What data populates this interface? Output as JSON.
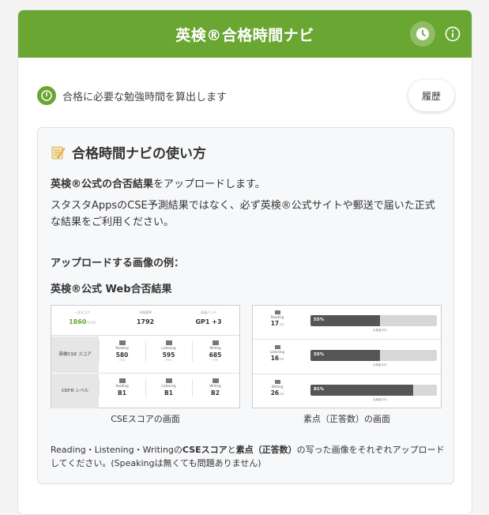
{
  "header": {
    "title": "英検®合格時間ナビ",
    "clock_icon": "clock-icon",
    "info_icon": "info-icon",
    "accent": "#6aa632"
  },
  "subheader": {
    "text": "合格に必要な勉強時間を算出します",
    "history_label": "履歴"
  },
  "howto": {
    "title": "合格時間ナビの使い方",
    "p1_bold": "英検®公式の合否結果",
    "p1_rest": "をアップロードします。",
    "p2": "スタスタAppsのCSE予測結果ではなく、必ず英検®公式サイトや郵送で届いた正式な結果をご利用ください。",
    "upload_heading": "アップロードする画像の例：",
    "web_heading": "英検®公式 Web合否結果",
    "caption_a": "CSEスコアの画面",
    "caption_b": "素点（正答数）の画面",
    "note_a": "Reading・Listening・Writingの",
    "note_b1": "CSEスコア",
    "note_c": "と",
    "note_b2": "素点（正答数）",
    "note_d": "の写った画像をそれぞれアップロードしてください。(Speakingは無くても問題ありません)"
  },
  "sample_cse": {
    "top": [
      {
        "label": "一次スコア",
        "value": "1860",
        "sub": "/2150",
        "green": true
      },
      {
        "label": "合格基準",
        "value": "1792",
        "green": false
      },
      {
        "label": "英検バンド",
        "value": "GP1 +3",
        "green": false
      }
    ],
    "row_cse_label": "英検CSE スコア",
    "row_cefr_label": "CEFR レベル",
    "skills": [
      {
        "name": "Reading",
        "cse": "580",
        "cse_max": "/750",
        "cefr": "B1"
      },
      {
        "name": "Listening",
        "cse": "595",
        "cse_max": "/750",
        "cefr": "B1"
      },
      {
        "name": "Writing",
        "cse": "685",
        "cse_max": "/750",
        "cefr": "B2"
      }
    ]
  },
  "sample_raw": [
    {
      "name": "Reading",
      "score": "17",
      "max": "/31",
      "percent": 55
    },
    {
      "name": "Listening",
      "score": "16",
      "max": "/29",
      "percent": 55
    },
    {
      "name": "Writing",
      "score": "26",
      "max": "/32",
      "percent": 81
    }
  ],
  "sample_raw_avg_label": "合格者平均"
}
